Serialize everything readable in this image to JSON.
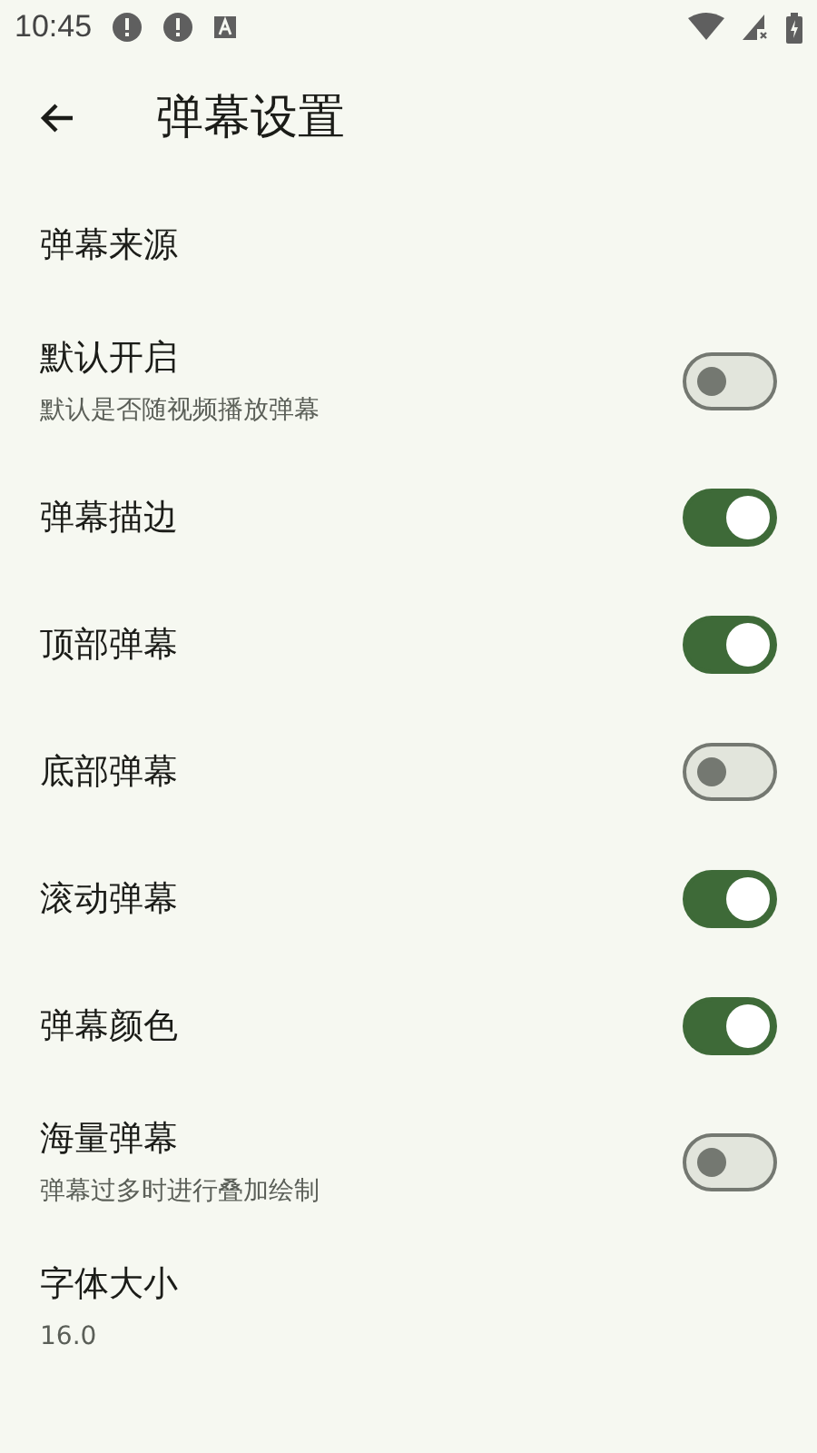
{
  "status_bar": {
    "time": "10:45"
  },
  "header": {
    "title": "弹幕设置"
  },
  "settings": [
    {
      "kind": "plain",
      "title": "弹幕来源"
    },
    {
      "kind": "switch",
      "title": "默认开启",
      "subtitle": "默认是否随视频播放弹幕",
      "on": false
    },
    {
      "kind": "switch",
      "title": "弹幕描边",
      "on": true
    },
    {
      "kind": "switch",
      "title": "顶部弹幕",
      "on": true
    },
    {
      "kind": "switch",
      "title": "底部弹幕",
      "on": false
    },
    {
      "kind": "switch",
      "title": "滚动弹幕",
      "on": true
    },
    {
      "kind": "switch",
      "title": "弹幕颜色",
      "on": true
    },
    {
      "kind": "switch",
      "title": "海量弹幕",
      "subtitle": "弹幕过多时进行叠加绘制",
      "on": false
    },
    {
      "kind": "plain",
      "title": "字体大小",
      "subtitle": "16.0"
    }
  ]
}
